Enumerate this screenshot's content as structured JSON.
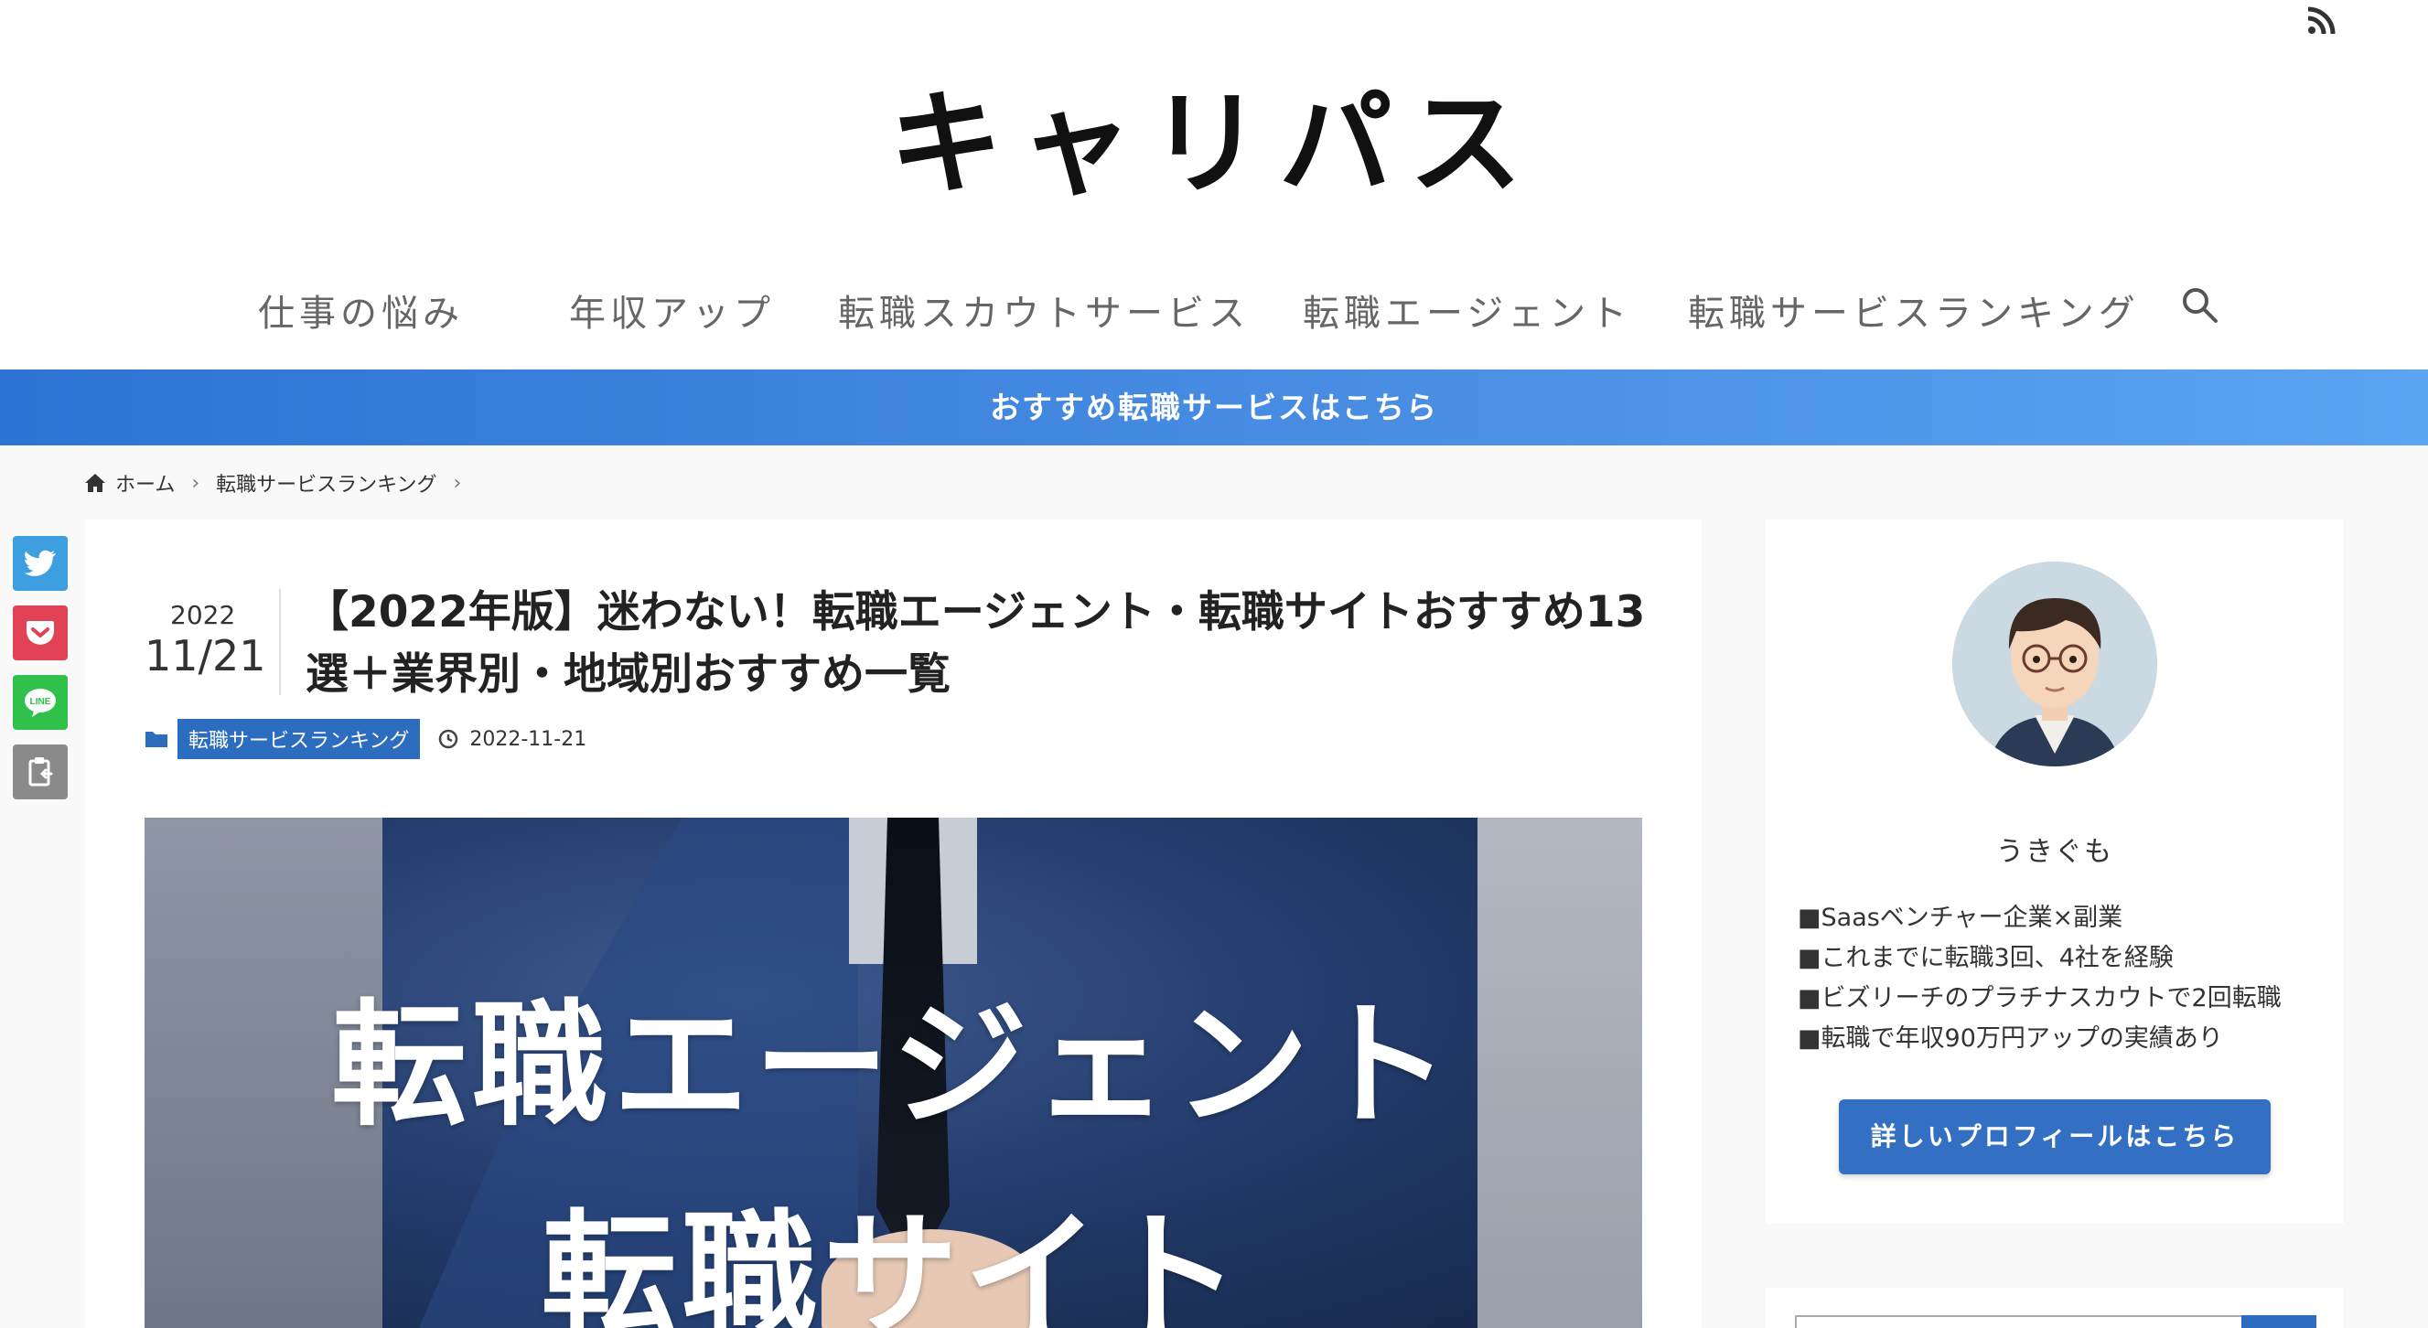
{
  "site": {
    "logo": "キャリパス",
    "rss_icon": "rss-icon"
  },
  "nav": {
    "items": [
      {
        "label": "仕事の悩み"
      },
      {
        "label": "年収アップ"
      },
      {
        "label": "転職スカウトサービス"
      },
      {
        "label": "転職エージェント"
      },
      {
        "label": "転職サービスランキング"
      }
    ],
    "search_icon": "search-icon"
  },
  "banner": {
    "label": "おすすめ転職サービスはこちら"
  },
  "breadcrumb": {
    "home": "ホーム",
    "category": "転職サービスランキング"
  },
  "share": {
    "twitter_icon": "twitter-icon",
    "pocket_icon": "pocket-icon",
    "line_icon": "line-icon",
    "copy_icon": "copy-icon",
    "line_text": "LINE",
    "colors": {
      "twitter": "#3e9fe0",
      "pocket": "#e14256",
      "line": "#2fc14a",
      "copy": "#8a8a8a"
    }
  },
  "article": {
    "date_year": "2022",
    "date_md": "11/21",
    "title": "【2022年版】迷わない！転職エージェント・転職サイトおすすめ13選＋業界別・地域別おすすめ一覧",
    "category": "転職サービスランキング",
    "updated": "2022-11-21",
    "eyecatch": {
      "line1": "転職エージェント",
      "line2": "転職サイト"
    }
  },
  "sidebar": {
    "profile_name": "うきぐも",
    "profile_lines": [
      "■Saasベンチャー企業×副業",
      "■これまでに転職3回、4社を経験",
      "■ビズリーチのプラチナスカウトで2回転職",
      "■転職で年収90万円アップの実績あり"
    ],
    "profile_button": "詳しいプロフィールはこちら"
  },
  "colors": {
    "accent": "#3370c4",
    "banner_start": "#2d74d4",
    "banner_end": "#5ba4f2",
    "tag": "#2d6dbf"
  }
}
